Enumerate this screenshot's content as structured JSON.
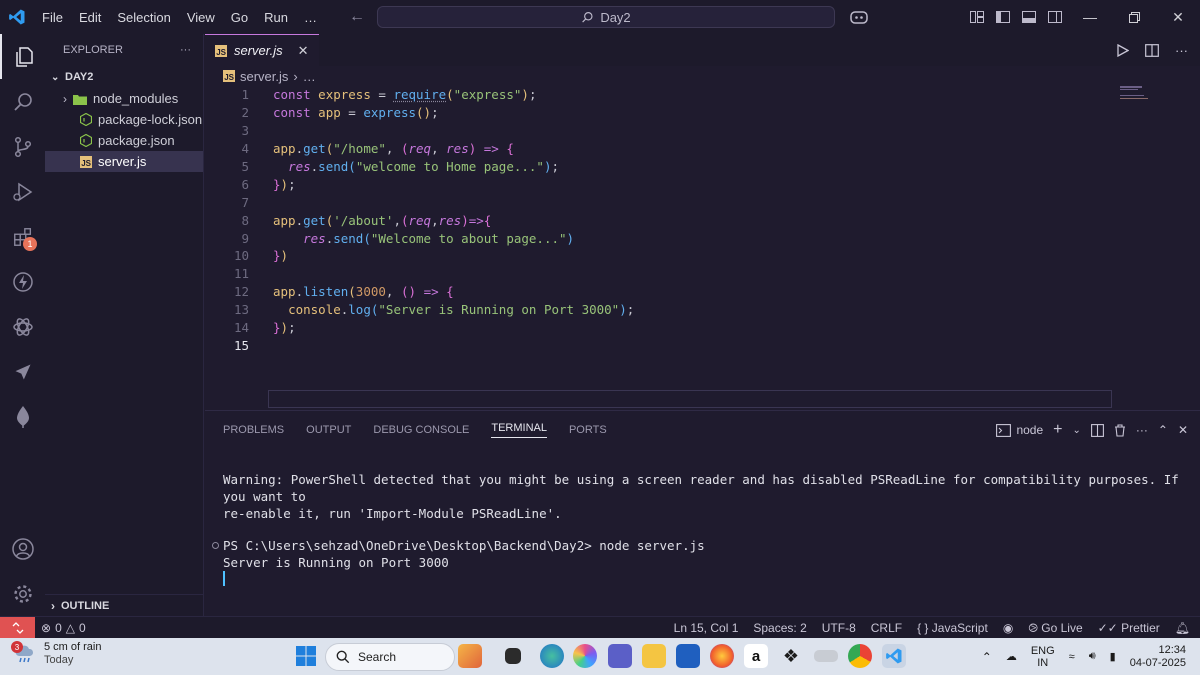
{
  "titlebar": {
    "menu": [
      "File",
      "Edit",
      "Selection",
      "View",
      "Go",
      "Run"
    ],
    "more": "…",
    "search_text": "Day2"
  },
  "activity": {
    "extensions_badge": "1"
  },
  "explorer": {
    "title": "EXPLORER",
    "more": "···",
    "folder": "DAY2",
    "items": [
      {
        "label": "node_modules"
      },
      {
        "label": "package-lock.json"
      },
      {
        "label": "package.json"
      },
      {
        "label": "server.js"
      }
    ],
    "outline": "OUTLINE"
  },
  "editor": {
    "tab_label": "server.js",
    "breadcrumb_file": "server.js",
    "breadcrumb_more": "…",
    "line_numbers": [
      "1",
      "2",
      "3",
      "4",
      "5",
      "6",
      "7",
      "8",
      "9",
      "10",
      "11",
      "12",
      "13",
      "14",
      "15"
    ]
  },
  "panel": {
    "tabs": [
      "PROBLEMS",
      "OUTPUT",
      "DEBUG CONSOLE",
      "TERMINAL",
      "PORTS"
    ],
    "shell": "node",
    "warning_line1": "Warning: PowerShell detected that you might be using a screen reader and has disabled PSReadLine for compatibility purposes. If you want to",
    "warning_line2": "re-enable it, run 'Import-Module PSReadLine'.",
    "prompt": "PS C:\\Users\\sehzad\\OneDrive\\Desktop\\Backend\\Day2> node server.js",
    "output": "Server is Running on Port 3000"
  },
  "status": {
    "problems": "0",
    "warnings": "0",
    "position": "Ln 15, Col 1",
    "spaces": "Spaces: 2",
    "encoding": "UTF-8",
    "eol": "CRLF",
    "language": "JavaScript",
    "golive": "Go Live",
    "prettier": "Prettier"
  },
  "taskbar": {
    "weather_badge": "3",
    "weather_text": "5 cm of rain",
    "weather_sub": "Today",
    "search": "Search",
    "lang1": "ENG",
    "lang2": "IN",
    "time": "12:34",
    "date": "04-07-2025"
  },
  "colors": {
    "accent": "#c678dd",
    "remote": "#e05252",
    "vscode_blue": "#2f9bf0"
  }
}
